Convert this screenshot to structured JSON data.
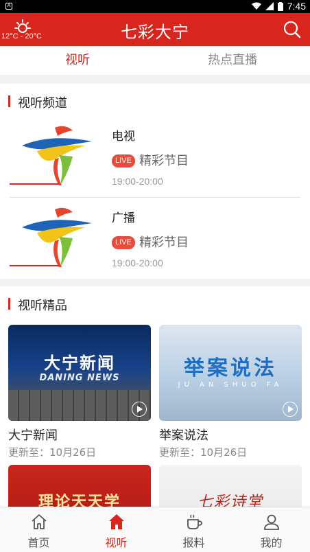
{
  "status_bar": {
    "time": "7:45"
  },
  "header": {
    "title": "七彩大宁",
    "temperature": "12°C - 20°C"
  },
  "tabs": [
    {
      "label": "视听"
    },
    {
      "label": "热点直播"
    }
  ],
  "channels_section": {
    "title": "视听频道",
    "channels": [
      {
        "name": "电视",
        "live_badge": "LIVE",
        "desc": "精彩节目",
        "time": "19:00-20:00"
      },
      {
        "name": "广播",
        "live_badge": "LIVE",
        "desc": "精彩节目",
        "time": "19:00-20:00"
      }
    ]
  },
  "featured_section": {
    "title": "视听精品",
    "cards": [
      {
        "name": "大宁新闻",
        "updated": "更新至：10月26日",
        "thumb_title": "大宁新闻",
        "thumb_subtitle": "DANING NEWS"
      },
      {
        "name": "举案说法",
        "updated": "更新至：10月26日",
        "thumb_title": "举案说法",
        "thumb_subtitle": "JU AN SHUO FA"
      },
      {
        "thumb_title": "理论天天学"
      },
      {
        "thumb_title": "七彩诗堂"
      }
    ]
  },
  "bottom_nav": [
    {
      "label": "首页",
      "icon": "home-outline-icon"
    },
    {
      "label": "视听",
      "icon": "home-filled-icon"
    },
    {
      "label": "报料",
      "icon": "coffee-cup-icon"
    },
    {
      "label": "我的",
      "icon": "user-icon"
    }
  ],
  "colors": {
    "brand_red": "#d8251d",
    "live_badge": "#e84c3d"
  }
}
